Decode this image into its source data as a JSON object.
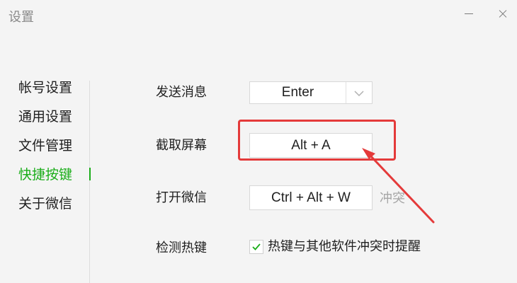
{
  "window": {
    "title": "设置"
  },
  "sidebar": {
    "items": [
      {
        "label": "帐号设置",
        "active": false
      },
      {
        "label": "通用设置",
        "active": false
      },
      {
        "label": "文件管理",
        "active": false
      },
      {
        "label": "快捷按键",
        "active": true
      },
      {
        "label": "关于微信",
        "active": false
      }
    ]
  },
  "shortcuts": {
    "send_message": {
      "label": "发送消息",
      "value": "Enter"
    },
    "screenshot": {
      "label": "截取屏幕",
      "value": "Alt + A"
    },
    "open_wechat": {
      "label": "打开微信",
      "value": "Ctrl + Alt + W",
      "conflict": "冲突"
    },
    "detect_hotkeys": {
      "label": "检测热键",
      "checkbox_label": "热键与其他软件冲突时提醒",
      "checked": true
    }
  },
  "colors": {
    "accent": "#1aad19",
    "annotation": "#e43a3a",
    "muted": "#a6a6a6"
  }
}
